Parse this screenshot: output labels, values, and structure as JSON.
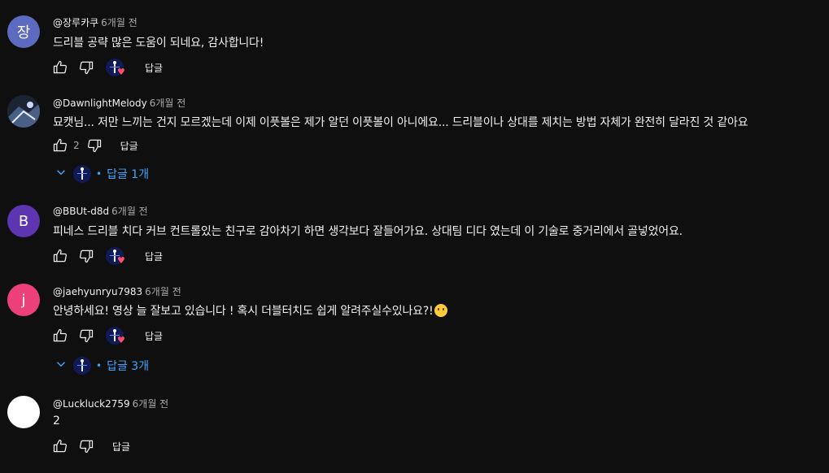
{
  "comments": [
    {
      "avatar_letter": "장",
      "avatar_color": "#5c6bc0",
      "author": "@장루카쿠",
      "time": "6개월 전",
      "text": "드리블 공략 많은 도움이 되네요, 감사합니다!",
      "likes": "",
      "reply_label": "답글"
    },
    {
      "avatar_letter": "",
      "avatar_color": "#2b3b52",
      "author": "@DawnlightMelody",
      "time": "6개월 전",
      "text": "묘캣님... 저만 느끼는 건지 모르겠는데 이제 이픗볼은 제가 알던 이픗볼이 아니에요... 드리블이나 상대를 제치는 방법 자체가 완전히 달라진 것 같아요",
      "likes": "2",
      "reply_label": "답글",
      "replies": "답글 1개"
    },
    {
      "avatar_letter": "B",
      "avatar_color": "#5e35b1",
      "author": "@BBUt-d8d",
      "time": "6개월 전",
      "text": "피네스 드리블 치다 커브 컨트롤있는 친구로 감아차기 하면 생각보다 잘들어가요. 상대팀 디다 였는데 이 기술로 중거리에서 골넣었어요.",
      "likes": "",
      "reply_label": "답글"
    },
    {
      "avatar_letter": "j",
      "avatar_color": "#ec407a",
      "author": "@jaehyunryu7983",
      "time": "6개월 전",
      "text": "안녕하세요! 영상 늘 잘보고 있습니다 ! 혹시 더블터치도 쉽게 알려주실수있나요?!",
      "likes": "",
      "reply_label": "답글",
      "replies": "답글 3개"
    },
    {
      "avatar_letter": "",
      "avatar_color": "#ffffff",
      "author": "@Luckluck2759",
      "time": "6개월 전",
      "text": "2",
      "likes": "",
      "reply_label": "답글"
    }
  ]
}
